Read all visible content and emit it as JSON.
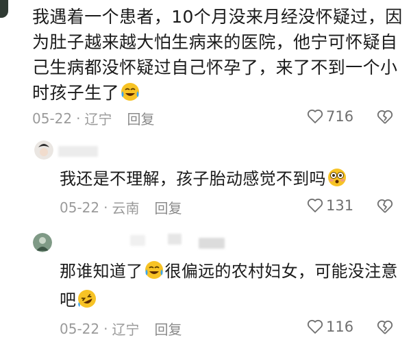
{
  "comment": {
    "text_parts": [
      "我遇着一个患者，10个月没来月经没怀疑过，因为肚子越来越大怕生病来的医院，他宁可怀疑自己生病都没怀疑过自己怀孕了，来了不到一个小时孩子生了"
    ],
    "emoji": "crying-laughing-emoji",
    "date": "05-22",
    "location": "辽宁",
    "reply_label": "回复",
    "likes": "716"
  },
  "replies": [
    {
      "text": "我还是不理解，孩子胎动感觉不到吗",
      "emoji": "flushed-emoji",
      "date": "05-22",
      "location": "云南",
      "reply_label": "回复",
      "likes": "131"
    },
    {
      "text_a": "那谁知道了",
      "text_b": "很偏远的农村妇女，可能没注意吧",
      "emoji_a": "crying-laughing-emoji",
      "emoji_b": "rolling-laughing-emoji",
      "date": "05-22",
      "location": "辽宁",
      "reply_label": "回复",
      "likes": "116"
    }
  ],
  "separator": "·",
  "colors": {
    "meta_gray": "#9a9a9a",
    "text": "#1a1a1a",
    "emoji_yellow": "#f7c325",
    "tear_blue": "#3aa5f0"
  }
}
